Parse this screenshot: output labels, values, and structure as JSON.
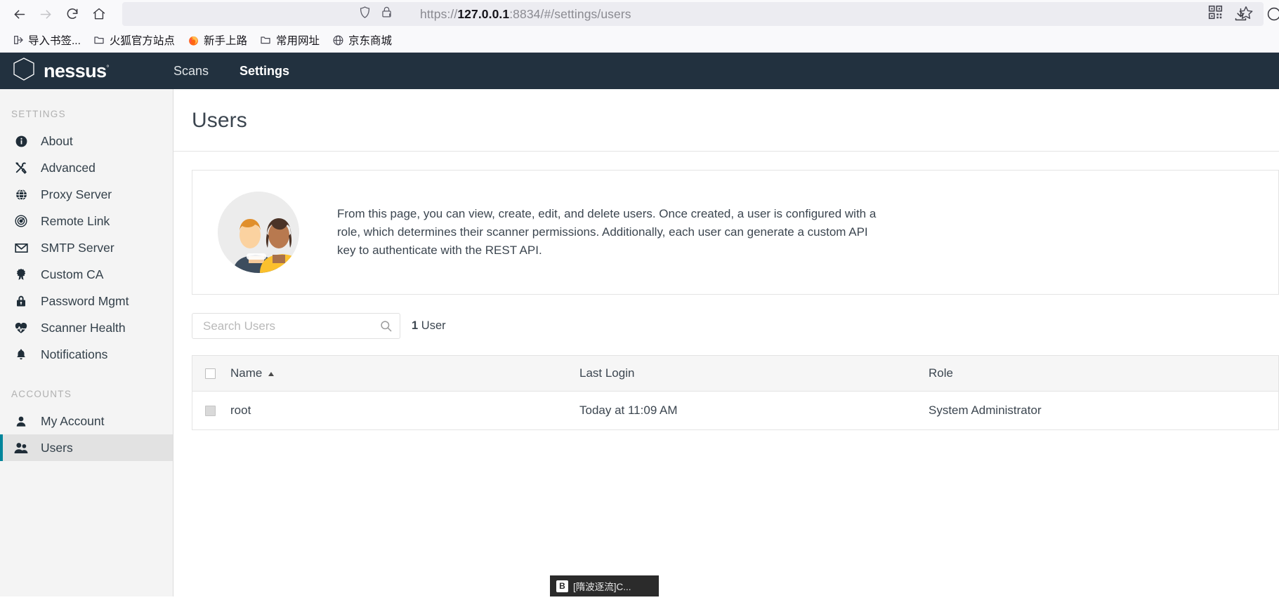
{
  "browser": {
    "nav": {
      "back_icon": "arrow-left-icon",
      "forward_icon": "arrow-right-icon",
      "reload_icon": "reload-icon",
      "home_icon": "home-icon"
    },
    "url": {
      "scheme": "https://",
      "host": "127.0.0.1",
      "rest": ":8834/#/settings/users",
      "full": "https://127.0.0.1:8834/#/settings/users",
      "shield_icon": "shield-icon",
      "lock_warning_icon": "lock-warning-icon",
      "qr_icon": "qr-code-icon",
      "bookmark_icon": "star-icon"
    },
    "toolbar_right": {
      "download_icon": "download-icon",
      "account_icon": "account-circle-icon"
    },
    "bookmarks": [
      {
        "label": "导入书签...",
        "icon": "import-bookmarks-icon"
      },
      {
        "label": "火狐官方站点",
        "icon": "folder-icon"
      },
      {
        "label": "新手上路",
        "icon": "firefox-icon"
      },
      {
        "label": "常用网址",
        "icon": "folder-icon"
      },
      {
        "label": "京东商城",
        "icon": "globe-icon"
      }
    ]
  },
  "app": {
    "brand": {
      "name": "nessus",
      "trademark": "®",
      "logo_icon": "hexagon-logo-icon"
    },
    "topnav": [
      {
        "label": "Scans",
        "active": false
      },
      {
        "label": "Settings",
        "active": true
      }
    ]
  },
  "sidebar": {
    "sections": [
      {
        "heading": "SETTINGS",
        "items": [
          {
            "label": "About",
            "icon": "info-circle-icon",
            "active": false
          },
          {
            "label": "Advanced",
            "icon": "tools-icon",
            "active": false
          },
          {
            "label": "Proxy Server",
            "icon": "globe-icon",
            "active": false
          },
          {
            "label": "Remote Link",
            "icon": "radar-icon",
            "active": false
          },
          {
            "label": "SMTP Server",
            "icon": "envelope-icon",
            "active": false
          },
          {
            "label": "Custom CA",
            "icon": "certificate-ribbon-icon",
            "active": false
          },
          {
            "label": "Password Mgmt",
            "icon": "lock-icon",
            "active": false
          },
          {
            "label": "Scanner Health",
            "icon": "heartbeat-icon",
            "active": false
          },
          {
            "label": "Notifications",
            "icon": "bell-icon",
            "active": false
          }
        ]
      },
      {
        "heading": "ACCOUNTS",
        "items": [
          {
            "label": "My Account",
            "icon": "user-icon",
            "active": false
          },
          {
            "label": "Users",
            "icon": "users-icon",
            "active": true
          }
        ]
      }
    ]
  },
  "main": {
    "title": "Users",
    "info_card": {
      "avatar_icon": "two-people-avatar-icon",
      "description": "From this page, you can view, create, edit, and delete users. Once created, a user is configured with a role, which determines their scanner permissions. Additionally, each user can generate a custom API key to authenticate with the REST API."
    },
    "search": {
      "placeholder": "Search Users",
      "value": "",
      "icon": "search-icon"
    },
    "count": {
      "number": "1",
      "unit": "User"
    },
    "table": {
      "columns": [
        "Name",
        "Last Login",
        "Role"
      ],
      "sort_column": "Name",
      "sort_direction": "asc",
      "sort_icon": "sort-ascending-icon",
      "select_all_icon": "checkbox-icon",
      "rows": [
        {
          "name": "root",
          "last_login": "Today at 11:09 AM",
          "role": "System Administrator",
          "checkbox_icon": "checkbox-disabled-icon"
        }
      ]
    }
  },
  "bottom_popup": {
    "badge": "B",
    "text": "[隋波逐流]C..."
  },
  "colors": {
    "brand_dark": "#22313f",
    "accent_teal": "#00859b",
    "text_primary": "#3c4650",
    "sidebar_bg": "#f4f4f4"
  }
}
